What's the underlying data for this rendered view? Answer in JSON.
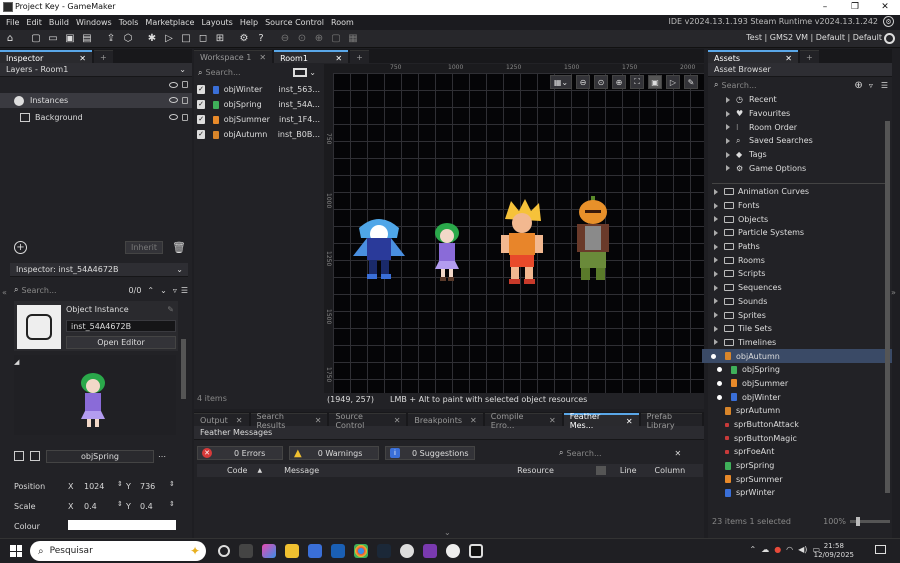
{
  "window": {
    "title": "Project Key - GameMaker",
    "min": "–",
    "max": "❐",
    "close": "✕"
  },
  "menu": {
    "items": [
      "File",
      "Edit",
      "Build",
      "Windows",
      "Tools",
      "Marketplace",
      "Layouts",
      "Help",
      "Source Control",
      "Room"
    ],
    "version": "IDE v2024.13.1.193 Steam  Runtime v2024.13.1.242"
  },
  "toolbar": {
    "targets": "Test | GMS2 VM | Default | Default"
  },
  "inspector": {
    "tab": "Inspector",
    "tab_add": "+",
    "layers_title": "Layers - Room1",
    "layers": [
      "Instances",
      "Background"
    ],
    "inherit": "Inherit",
    "inspector_title": "Inspector: inst_54A4672B",
    "search_placeholder": "Search...",
    "search_count": "0/0",
    "object_instance": "Object Instance",
    "instance_name": "inst_54A4672B",
    "open_editor": "Open Editor",
    "object_name": "objSpring",
    "position_label": "Position",
    "position_x_label": "X",
    "position_x": "1024",
    "position_y_label": "Y",
    "position_y": "736",
    "scale_label": "Scale",
    "scale_x_label": "X",
    "scale_x": "0.4",
    "scale_y_label": "Y",
    "scale_y": "0.4",
    "colour_label": "Colour"
  },
  "workspace": {
    "tabs": [
      "Workspace 1",
      "Room1"
    ],
    "tab_add": "+",
    "search_placeholder": "Search...",
    "instances": [
      {
        "obj": "objWinter",
        "inst": "inst_563..."
      },
      {
        "obj": "objSpring",
        "inst": "inst_54A..."
      },
      {
        "obj": "objSummer",
        "inst": "inst_1F4..."
      },
      {
        "obj": "objAutumn",
        "inst": "inst_B0B..."
      }
    ],
    "items_count": "4 items",
    "ruler_top": [
      "750",
      "1000",
      "1250",
      "1500",
      "1750",
      "2000"
    ],
    "ruler_left": [
      "750",
      "1000",
      "1250",
      "1500",
      "1750"
    ],
    "coords": "(1949, 257)",
    "hint": "LMB + Alt to paint with selected object resources"
  },
  "output": {
    "tabs": [
      "Output",
      "Search Results",
      "Source Control",
      "Breakpoints",
      "Compile Erro...",
      "Feather Mes...",
      "Prefab Library"
    ],
    "header": "Feather Messages",
    "errors": "0 Errors",
    "warnings": "0 Warnings",
    "suggestions": "0 Suggestions",
    "search_placeholder": "Search...",
    "columns": [
      "Code",
      "Message",
      "Resource",
      "Line",
      "Column"
    ]
  },
  "assets": {
    "tab": "Assets",
    "tab_add": "+",
    "header": "Asset Browser",
    "search_placeholder": "Search...",
    "quick": [
      "Recent",
      "Favourites",
      "Room Order",
      "Saved Searches",
      "Tags",
      "Game Options"
    ],
    "folders": [
      "Animation Curves",
      "Fonts",
      "Objects",
      "Particle Systems",
      "Paths",
      "Rooms",
      "Scripts",
      "Sequences",
      "Sounds",
      "Sprites",
      "Tile Sets",
      "Timelines"
    ],
    "objects": [
      "objAutumn",
      "objSpring",
      "objSummer",
      "objWinter"
    ],
    "sprites": [
      "sprAutumn",
      "sprButtonAttack",
      "sprButtonMagic",
      "sprFoeAnt",
      "sprSpring",
      "sprSummer",
      "sprWinter"
    ],
    "status": "23 items   1 selected",
    "zoom": "100%"
  },
  "taskbar": {
    "search": "Pesquisar",
    "time": "21:58",
    "date": "12/09/2025"
  },
  "colors": {
    "accent": "#5aa7e8",
    "selected": "#3a4a66"
  }
}
